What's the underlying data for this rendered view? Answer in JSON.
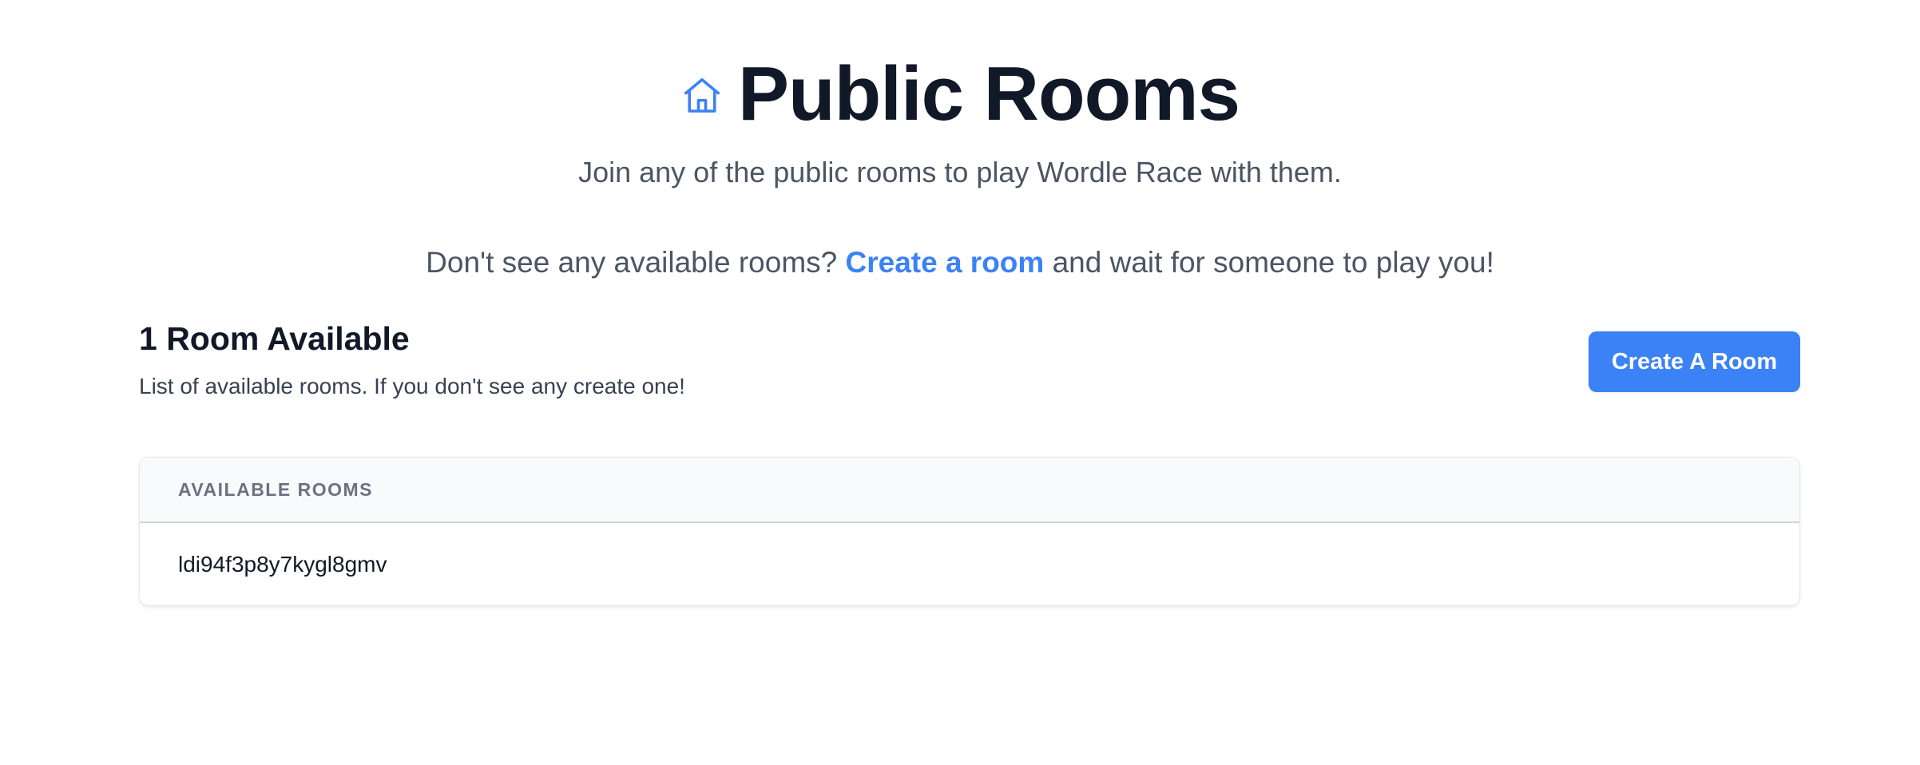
{
  "hero": {
    "title": "Public Rooms",
    "icon": "home-icon",
    "subtitle": "Join any of the public rooms to play Wordle Race with them.",
    "cta_prefix": "Don't see any available rooms? ",
    "cta_link": "Create a room",
    "cta_suffix": " and wait for someone to play you!"
  },
  "section": {
    "title": "1 Room Available",
    "description": "List of available rooms. If you don't see any create one!",
    "create_button_label": "Create A Room"
  },
  "rooms_table": {
    "header": "AVAILABLE ROOMS",
    "rooms": [
      "ldi94f3p8y7kygl8gmv"
    ]
  },
  "colors": {
    "accent": "#3b82f6",
    "title": "#111827",
    "muted": "#4b5563"
  }
}
